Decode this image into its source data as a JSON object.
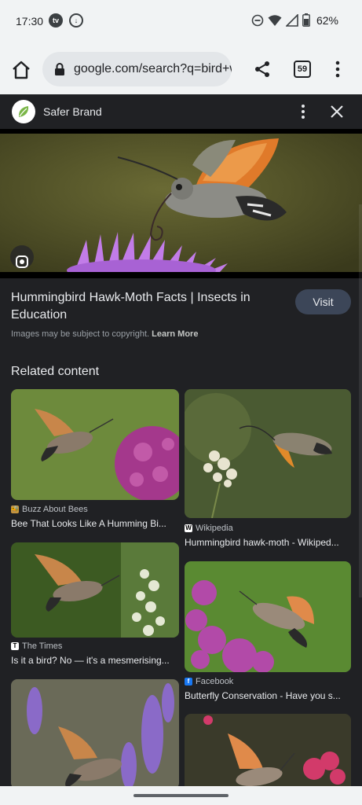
{
  "status": {
    "time": "17:30",
    "battery": "62%",
    "icon_tv": "tv"
  },
  "browser": {
    "url": "google.com/search?q=bird+w",
    "tab_count": "59"
  },
  "source": {
    "name": "Safer Brand"
  },
  "result": {
    "title": "Hummingbird Hawk-Moth Facts | Insects in Education",
    "visit_label": "Visit",
    "copyright_text": "Images may be subject to copyright.",
    "learn_more": "Learn More"
  },
  "related": {
    "heading": "Related content",
    "left": [
      {
        "source": "Buzz About Bees",
        "favicon": "🐝",
        "title": "Bee That Looks Like A Humming Bi..."
      },
      {
        "source": "The Times",
        "favicon": "T",
        "title": "Is it a bird? No — it's a mesmerising..."
      },
      {
        "source": "",
        "favicon": "",
        "title": ""
      }
    ],
    "right": [
      {
        "source": "Wikipedia",
        "favicon": "W",
        "title": "Hummingbird hawk-moth - Wikiped..."
      },
      {
        "source": "Facebook",
        "favicon": "f",
        "title": "Butterfly Conservation - Have you s..."
      },
      {
        "source": "",
        "favicon": "",
        "title": ""
      }
    ]
  },
  "colors": {
    "panel_bg": "#202124",
    "visit_bg": "#3c4658",
    "chrome_bg": "#f1f3f4"
  }
}
